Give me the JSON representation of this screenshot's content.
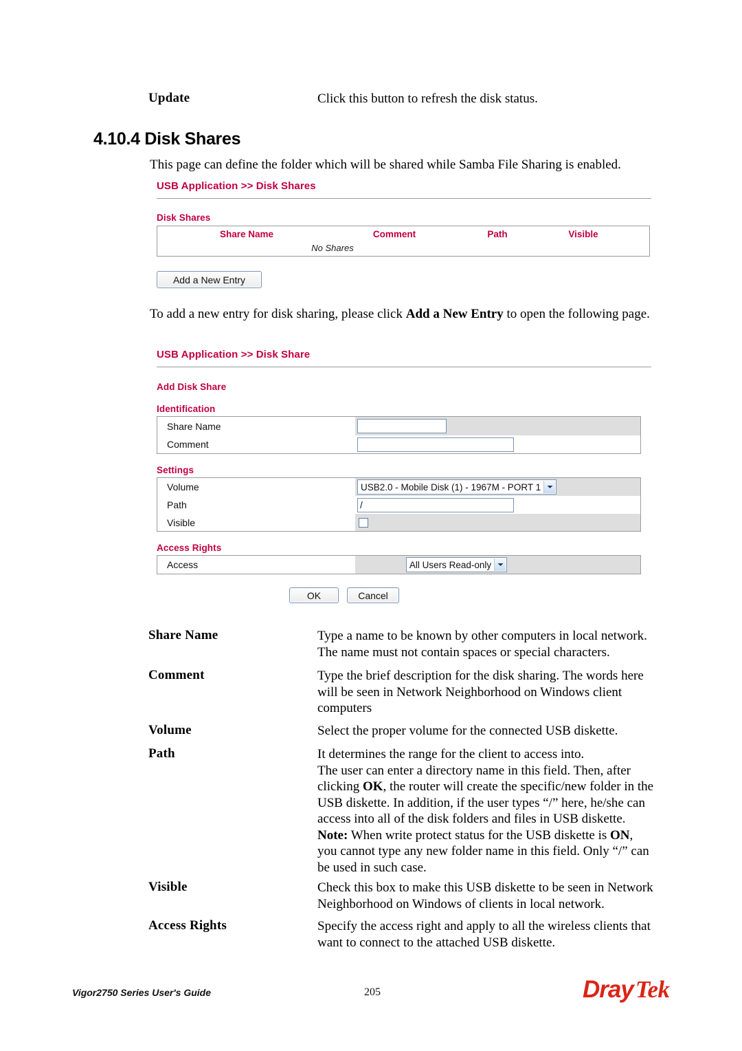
{
  "document": {
    "top_entry": {
      "term": "Update",
      "description": "Click this button to refresh the disk status."
    },
    "heading": "4.10.4 Disk Shares",
    "intro": "This page can define the folder which will be shared while Samba File Sharing is enabled.",
    "mid_paragraph": {
      "before": "To add a new entry for disk sharing, please click ",
      "bold": "Add a New Entry",
      "after": " to open the following page."
    },
    "definitions": [
      {
        "term": "Share Name",
        "lines": [
          "Type a name to be known by other computers in local network.",
          "The name must not contain spaces or special characters."
        ]
      },
      {
        "term": "Comment",
        "lines": [
          "Type the brief description for the disk sharing. The words here",
          "will be seen in Network Neighborhood on Windows client",
          "computers"
        ]
      },
      {
        "term": "Volume",
        "lines": [
          "Select the proper volume for the connected USB diskette."
        ]
      },
      {
        "term": "Path",
        "lines": [
          "It determines the range for the client to access into.",
          "The user can enter a directory name in this field. Then, after",
          "clicking OK, the router will create the specific/new folder in the",
          "USB diskette. In addition, if the user types “/” here, he/she can",
          "access into all of the disk folders and files in USB diskette.",
          "Note: When write protect status for the USB diskette is ON,",
          "you cannot type any new folder name in this field. Only “/” can",
          "be used in such case."
        ]
      },
      {
        "term": "Visible",
        "lines": [
          "Check this box to make this USB diskette to be seen in Network",
          "Neighborhood on Windows of clients in local network."
        ]
      },
      {
        "term": "Access Rights",
        "lines": [
          "Specify the access right and apply to all the wireless clients that",
          "want to connect to the attached USB diskette."
        ]
      }
    ]
  },
  "screenshot_disk_shares": {
    "breadcrumb": "USB Application >> Disk Shares",
    "section_label": "Disk Shares",
    "table": {
      "columns": [
        "Share Name",
        "Comment",
        "Path",
        "Visible"
      ],
      "empty_message": "No Shares",
      "rows": []
    },
    "add_button": "Add a New Entry"
  },
  "screenshot_disk_share_form": {
    "breadcrumb": "USB Application >> Disk Share",
    "form_title": "Add Disk Share",
    "identification": {
      "section_label": "Identification",
      "fields": [
        {
          "label": "Share Name",
          "value": "",
          "placeholder": ""
        },
        {
          "label": "Comment",
          "value": "",
          "placeholder": ""
        }
      ]
    },
    "settings": {
      "section_label": "Settings",
      "volume": {
        "label": "Volume",
        "selected": "USB2.0   - Mobile Disk      (1) - 1967M - PORT 1"
      },
      "path": {
        "label": "Path",
        "value": "/"
      },
      "visible": {
        "label": "Visible",
        "checked": false
      }
    },
    "access_rights": {
      "section_label": "Access Rights",
      "access": {
        "label": "Access",
        "selected": "All Users Read-only"
      }
    },
    "buttons": {
      "ok": "OK",
      "cancel": "Cancel"
    }
  },
  "footer": {
    "guide": "Vigor2750 Series User's Guide",
    "page_number": "205",
    "logo_part1": "Dray",
    "logo_part2": "Tek"
  },
  "colors": {
    "ui_heading": "#C00040",
    "logo_red": "#D92518",
    "shaded_cell": "#DEDEDE",
    "border_gray": "#9B9B9B",
    "input_border": "#7A95B5"
  }
}
